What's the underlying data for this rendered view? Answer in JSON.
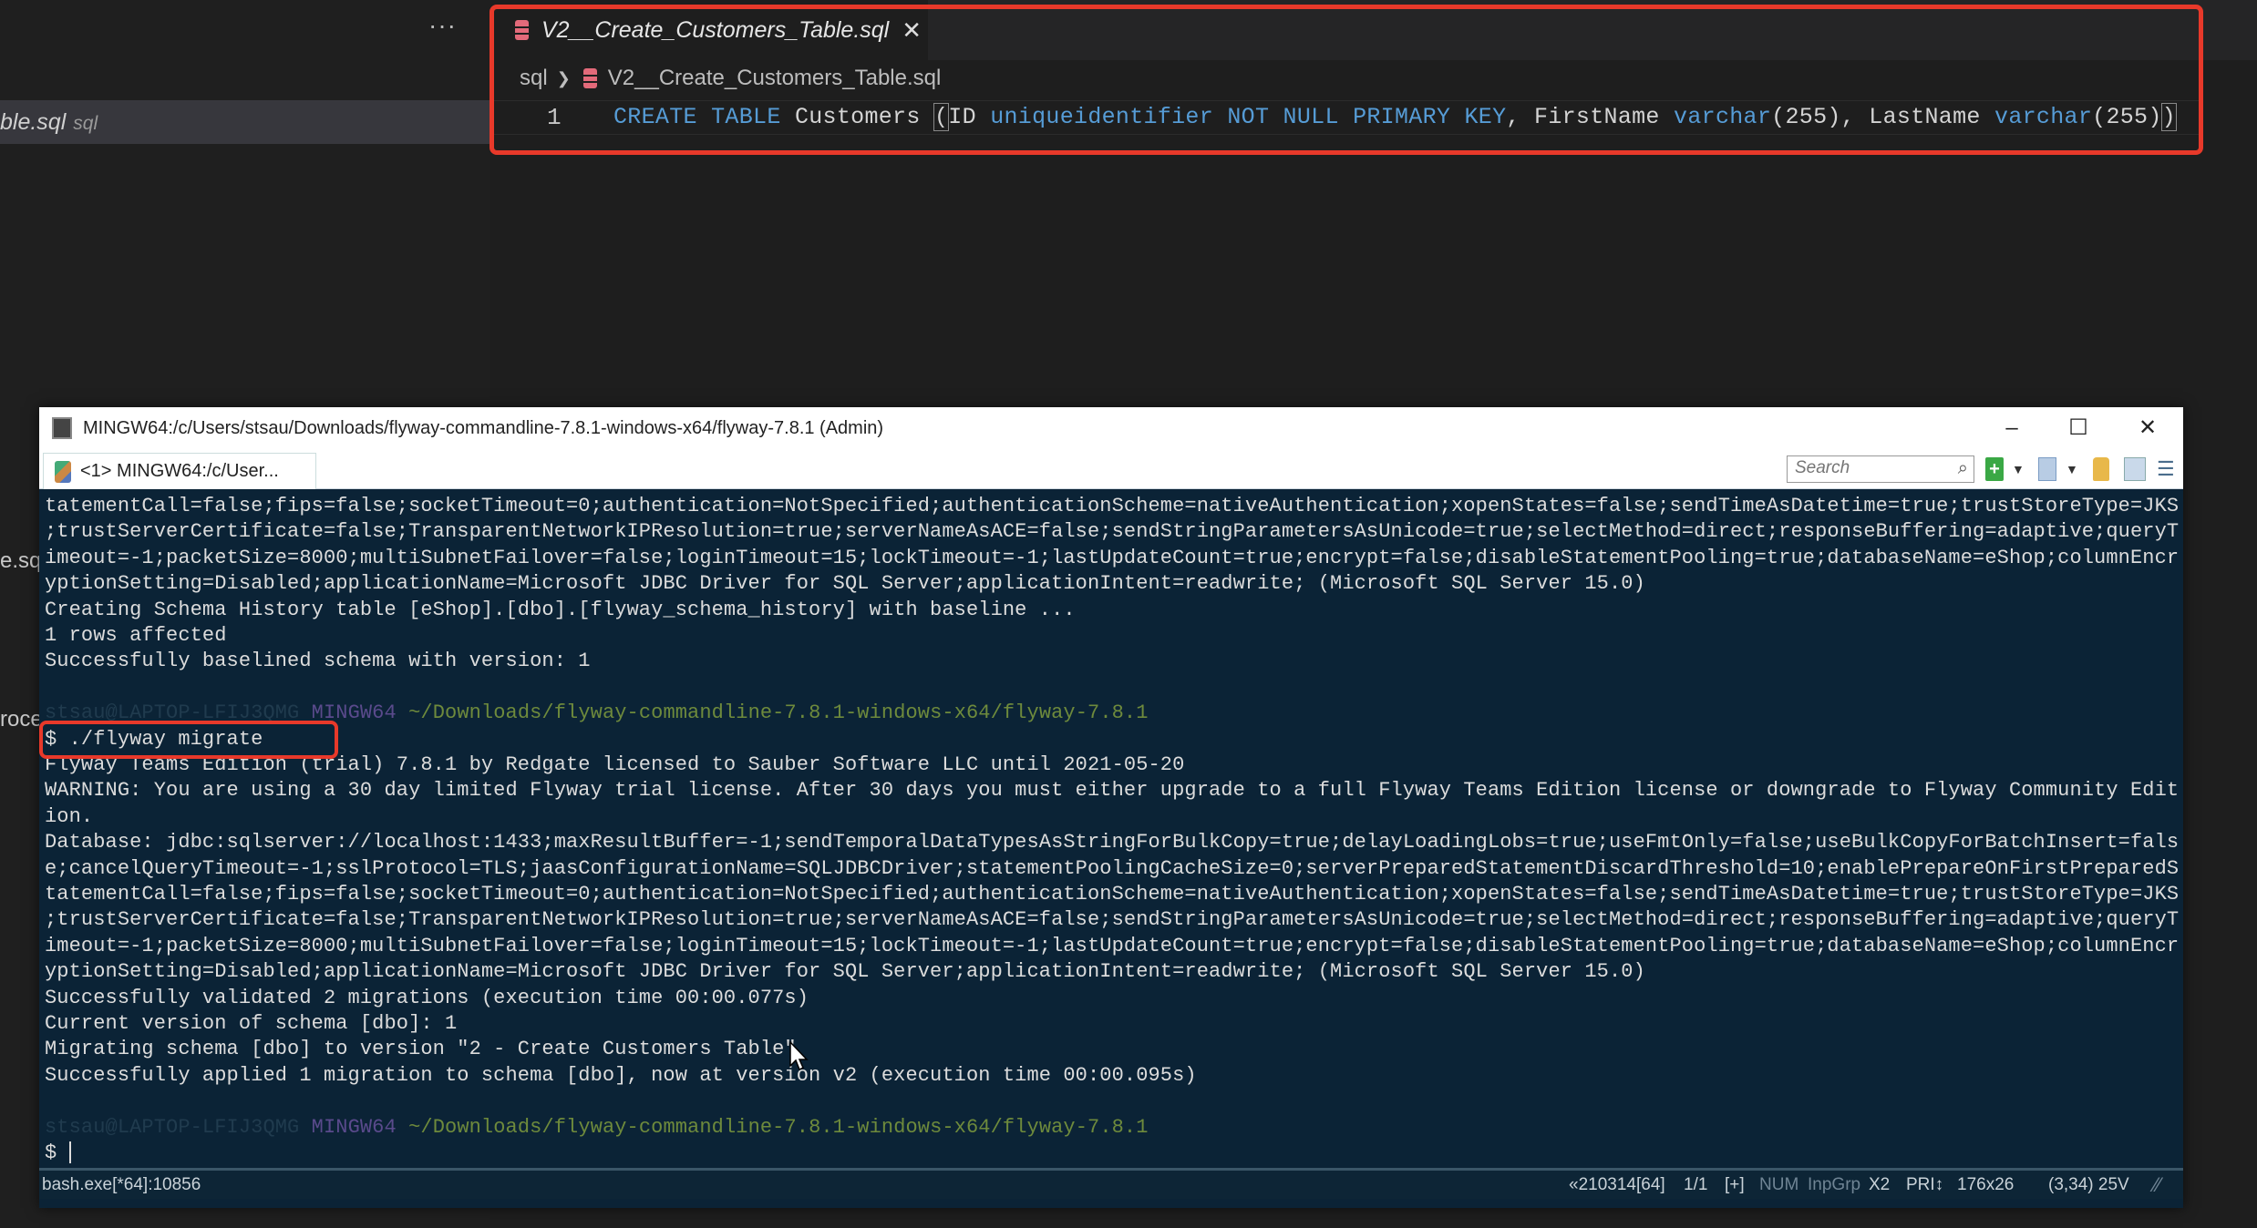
{
  "vscode": {
    "sidebar": {
      "more_label": "···",
      "selected_file": "ble.sql",
      "selected_lang": "sql",
      "fragment_1": "e.sq",
      "fragment_2": "roce"
    },
    "tab": {
      "label": "V2__Create_Customers_Table.sql",
      "close": "✕",
      "icon": "database-icon"
    },
    "breadcrumb": {
      "folder": "sql",
      "separator": "❯",
      "file": "V2__Create_Customers_Table.sql"
    },
    "code": {
      "line_number": "1",
      "tokens": [
        {
          "t": "CREATE TABLE ",
          "c": "kw"
        },
        {
          "t": "Customers ",
          "c": ""
        },
        {
          "t": "(",
          "c": "bracket"
        },
        {
          "t": "ID ",
          "c": ""
        },
        {
          "t": "uniqueidentifier NOT NULL PRIMARY KEY",
          "c": "kw"
        },
        {
          "t": ", FirstName ",
          "c": ""
        },
        {
          "t": "varchar",
          "c": "ty"
        },
        {
          "t": "(255), LastName ",
          "c": ""
        },
        {
          "t": "varchar",
          "c": "ty"
        },
        {
          "t": "(255)",
          "c": ""
        },
        {
          "t": ")",
          "c": "bracket"
        }
      ]
    },
    "highlight_color": "#e8392a"
  },
  "terminal": {
    "title": "MINGW64:/c/Users/stsau/Downloads/flyway-commandline-7.8.1-windows-x64/flyway-7.8.1 (Admin)",
    "controls": {
      "minimize": "–",
      "maximize": "☐",
      "close": "✕"
    },
    "tab_label": "<1> MINGW64:/c/User...",
    "search_placeholder": "Search",
    "background": "#0b2336",
    "lines": [
      {
        "text": "tatementCall=false;fips=false;socketTimeout=0;authentication=NotSpecified;authenticationScheme=nativeAuthentication;xopenStates=false;sendTimeAsDatetime=true;trustStoreType=JKS"
      },
      {
        "text": ";trustServerCertificate=false;TransparentNetworkIPResolution=true;serverNameAsACE=false;sendStringParametersAsUnicode=true;selectMethod=direct;responseBuffering=adaptive;queryT"
      },
      {
        "text": "imeout=-1;packetSize=8000;multiSubnetFailover=false;loginTimeout=15;lockTimeout=-1;lastUpdateCount=true;encrypt=false;disableStatementPooling=true;databaseName=eShop;columnEncr"
      },
      {
        "text": "yptionSetting=Disabled;applicationName=Microsoft JDBC Driver for SQL Server;applicationIntent=readwrite; (Microsoft SQL Server 15.0)"
      },
      {
        "text": "Creating Schema History table [eShop].[dbo].[flyway_schema_history] with baseline ..."
      },
      {
        "text": "1 rows affected"
      },
      {
        "text": "Successfully baselined schema with version: 1"
      },
      {
        "text": ""
      },
      {
        "prompt": {
          "user": "stsau@LAPTOP-LFIJ3QMG",
          "host": "MINGW64",
          "path": "~/Downloads/flyway-commandline-7.8.1-windows-x64/flyway-7.8.1"
        }
      },
      {
        "text": "$ ./flyway migrate"
      },
      {
        "text": "Flyway Teams Edition (trial) 7.8.1 by Redgate licensed to Sauber Software LLC until 2021-05-20"
      },
      {
        "text": "WARNING: You are using a 30 day limited Flyway trial license. After 30 days you must either upgrade to a full Flyway Teams Edition license or downgrade to Flyway Community Edit"
      },
      {
        "text": "ion."
      },
      {
        "text": "Database: jdbc:sqlserver://localhost:1433;maxResultBuffer=-1;sendTemporalDataTypesAsStringForBulkCopy=true;delayLoadingLobs=true;useFmtOnly=false;useBulkCopyForBatchInsert=fals"
      },
      {
        "text": "e;cancelQueryTimeout=-1;sslProtocol=TLS;jaasConfigurationName=SQLJDBCDriver;statementPoolingCacheSize=0;serverPreparedStatementDiscardThreshold=10;enablePrepareOnFirstPreparedS"
      },
      {
        "text": "tatementCall=false;fips=false;socketTimeout=0;authentication=NotSpecified;authenticationScheme=nativeAuthentication;xopenStates=false;sendTimeAsDatetime=true;trustStoreType=JKS"
      },
      {
        "text": ";trustServerCertificate=false;TransparentNetworkIPResolution=true;serverNameAsACE=false;sendStringParametersAsUnicode=true;selectMethod=direct;responseBuffering=adaptive;queryT"
      },
      {
        "text": "imeout=-1;packetSize=8000;multiSubnetFailover=false;loginTimeout=15;lockTimeout=-1;lastUpdateCount=true;encrypt=false;disableStatementPooling=true;databaseName=eShop;columnEncr"
      },
      {
        "text": "yptionSetting=Disabled;applicationName=Microsoft JDBC Driver for SQL Server;applicationIntent=readwrite; (Microsoft SQL Server 15.0)"
      },
      {
        "text": "Successfully validated 2 migrations (execution time 00:00.077s)"
      },
      {
        "text": "Current version of schema [dbo]: 1"
      },
      {
        "text": "Migrating schema [dbo] to version \"2 - Create Customers Table\""
      },
      {
        "text": "Successfully applied 1 migration to schema [dbo], now at version v2 (execution time 00:00.095s)"
      },
      {
        "text": ""
      },
      {
        "prompt": {
          "user": "stsau@LAPTOP-LFIJ3QMG",
          "host": "MINGW64",
          "path": "~/Downloads/flyway-commandline-7.8.1-windows-x64/flyway-7.8.1"
        }
      },
      {
        "text": "$ ",
        "cursor": true
      }
    ],
    "status": {
      "process": "bash.exe[*64]:10856",
      "build": "«210314[64]",
      "console": "1/1",
      "plus": "[+]",
      "num": "NUM",
      "inpgrp": "InpGrp",
      "x2": "X2",
      "pri": "PRI↕",
      "size": "176x26",
      "cursor_pos": "(3,34) 25V"
    }
  }
}
